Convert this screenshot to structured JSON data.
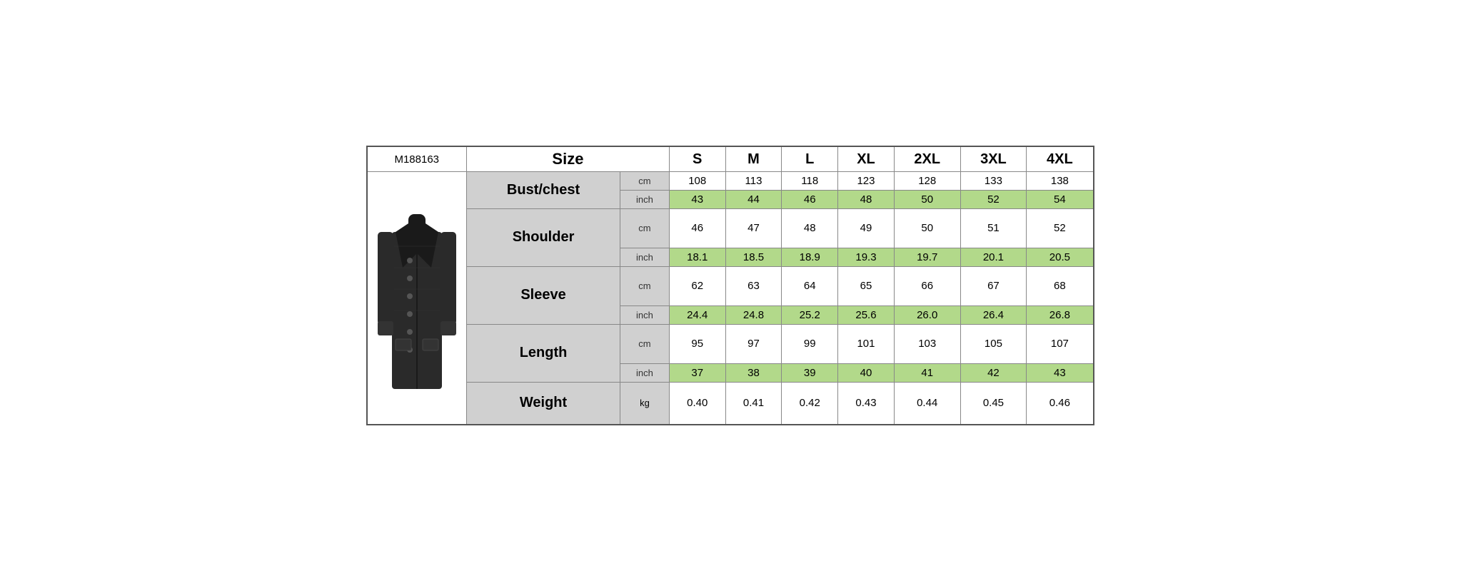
{
  "product": {
    "id": "M188163"
  },
  "header": {
    "size_label": "Size",
    "sizes": [
      "S",
      "M",
      "L",
      "XL",
      "2XL",
      "3XL",
      "4XL"
    ]
  },
  "rows": [
    {
      "label": "Bust/chest",
      "units": [
        "cm",
        "inch"
      ],
      "values_cm": [
        "108",
        "113",
        "118",
        "123",
        "128",
        "133",
        "138"
      ],
      "values_inch": [
        "43",
        "44",
        "46",
        "48",
        "50",
        "52",
        "54"
      ]
    },
    {
      "label": "Shoulder",
      "units": [
        "cm",
        "inch"
      ],
      "values_cm": [
        "46",
        "47",
        "48",
        "49",
        "50",
        "51",
        "52"
      ],
      "values_inch": [
        "18.1",
        "18.5",
        "18.9",
        "19.3",
        "19.7",
        "20.1",
        "20.5"
      ]
    },
    {
      "label": "Sleeve",
      "units": [
        "cm",
        "inch"
      ],
      "values_cm": [
        "62",
        "63",
        "64",
        "65",
        "66",
        "67",
        "68"
      ],
      "values_inch": [
        "24.4",
        "24.8",
        "25.2",
        "25.6",
        "26.0",
        "26.4",
        "26.8"
      ]
    },
    {
      "label": "Length",
      "units": [
        "cm",
        "inch"
      ],
      "values_cm": [
        "95",
        "97",
        "99",
        "101",
        "103",
        "105",
        "107"
      ],
      "values_inch": [
        "37",
        "38",
        "39",
        "40",
        "41",
        "42",
        "43"
      ]
    },
    {
      "label": "Weight",
      "unit": "kg",
      "values": [
        "0.40",
        "0.41",
        "0.42",
        "0.43",
        "0.44",
        "0.45",
        "0.46"
      ]
    }
  ]
}
